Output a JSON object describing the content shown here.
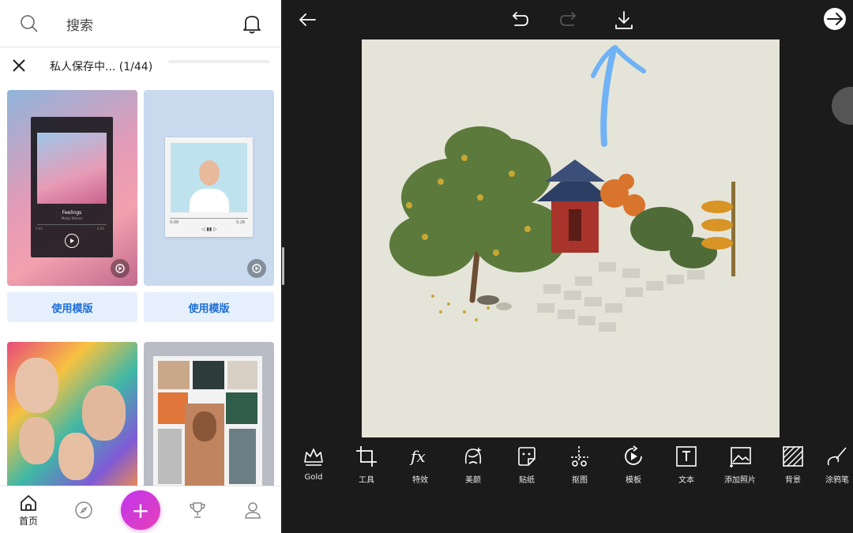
{
  "colors": {
    "accent_blue": "#1d6ed6",
    "button_bg": "#e6f0fd",
    "plus_gradient_start": "#c036f0",
    "plus_gradient_end": "#e63fb6",
    "editor_bg": "#1b1b1b",
    "canvas_bg": "#e5e4d8",
    "annotation_arrow": "#6fb2f5"
  },
  "search": {
    "placeholder": "搜索",
    "icon": "search-icon",
    "notification_icon": "bell-icon"
  },
  "save_status": {
    "text": "私人保存中... (1/44)",
    "close_icon": "close-icon"
  },
  "templates": [
    {
      "use_label": "使用模版",
      "music_song": "Feelings",
      "music_artist": "Maisy Stenco",
      "time_start": "0:00",
      "time_end": "4:00"
    },
    {
      "use_label": "使用模版",
      "time_start": "0:00",
      "time_end": "5:26"
    }
  ],
  "bottom_nav": {
    "items": [
      {
        "icon": "home-icon",
        "label": "首页"
      },
      {
        "icon": "compass-icon"
      },
      {
        "icon": "plus-icon",
        "label": "+"
      },
      {
        "icon": "trophy-icon"
      },
      {
        "icon": "profile-icon"
      }
    ]
  },
  "editor": {
    "topbar_icons": [
      "back-arrow-icon",
      "undo-icon",
      "redo-icon",
      "download-icon",
      "next-arrow-icon"
    ],
    "tools": [
      {
        "icon": "crown-icon",
        "label": "Gold"
      },
      {
        "icon": "crop-icon",
        "label": "工具"
      },
      {
        "icon": "fx-icon",
        "label": "特效"
      },
      {
        "icon": "beauty-icon",
        "label": "美颜"
      },
      {
        "icon": "sticker-icon",
        "label": "贴纸"
      },
      {
        "icon": "cutout-icon",
        "label": "抠图"
      },
      {
        "icon": "template-icon",
        "label": "模板"
      },
      {
        "icon": "text-icon",
        "label": "文本"
      },
      {
        "icon": "add-photo-icon",
        "label": "添加照片"
      },
      {
        "icon": "background-icon",
        "label": "背景"
      },
      {
        "icon": "draw-icon",
        "label": "涂鸦笔"
      }
    ]
  }
}
